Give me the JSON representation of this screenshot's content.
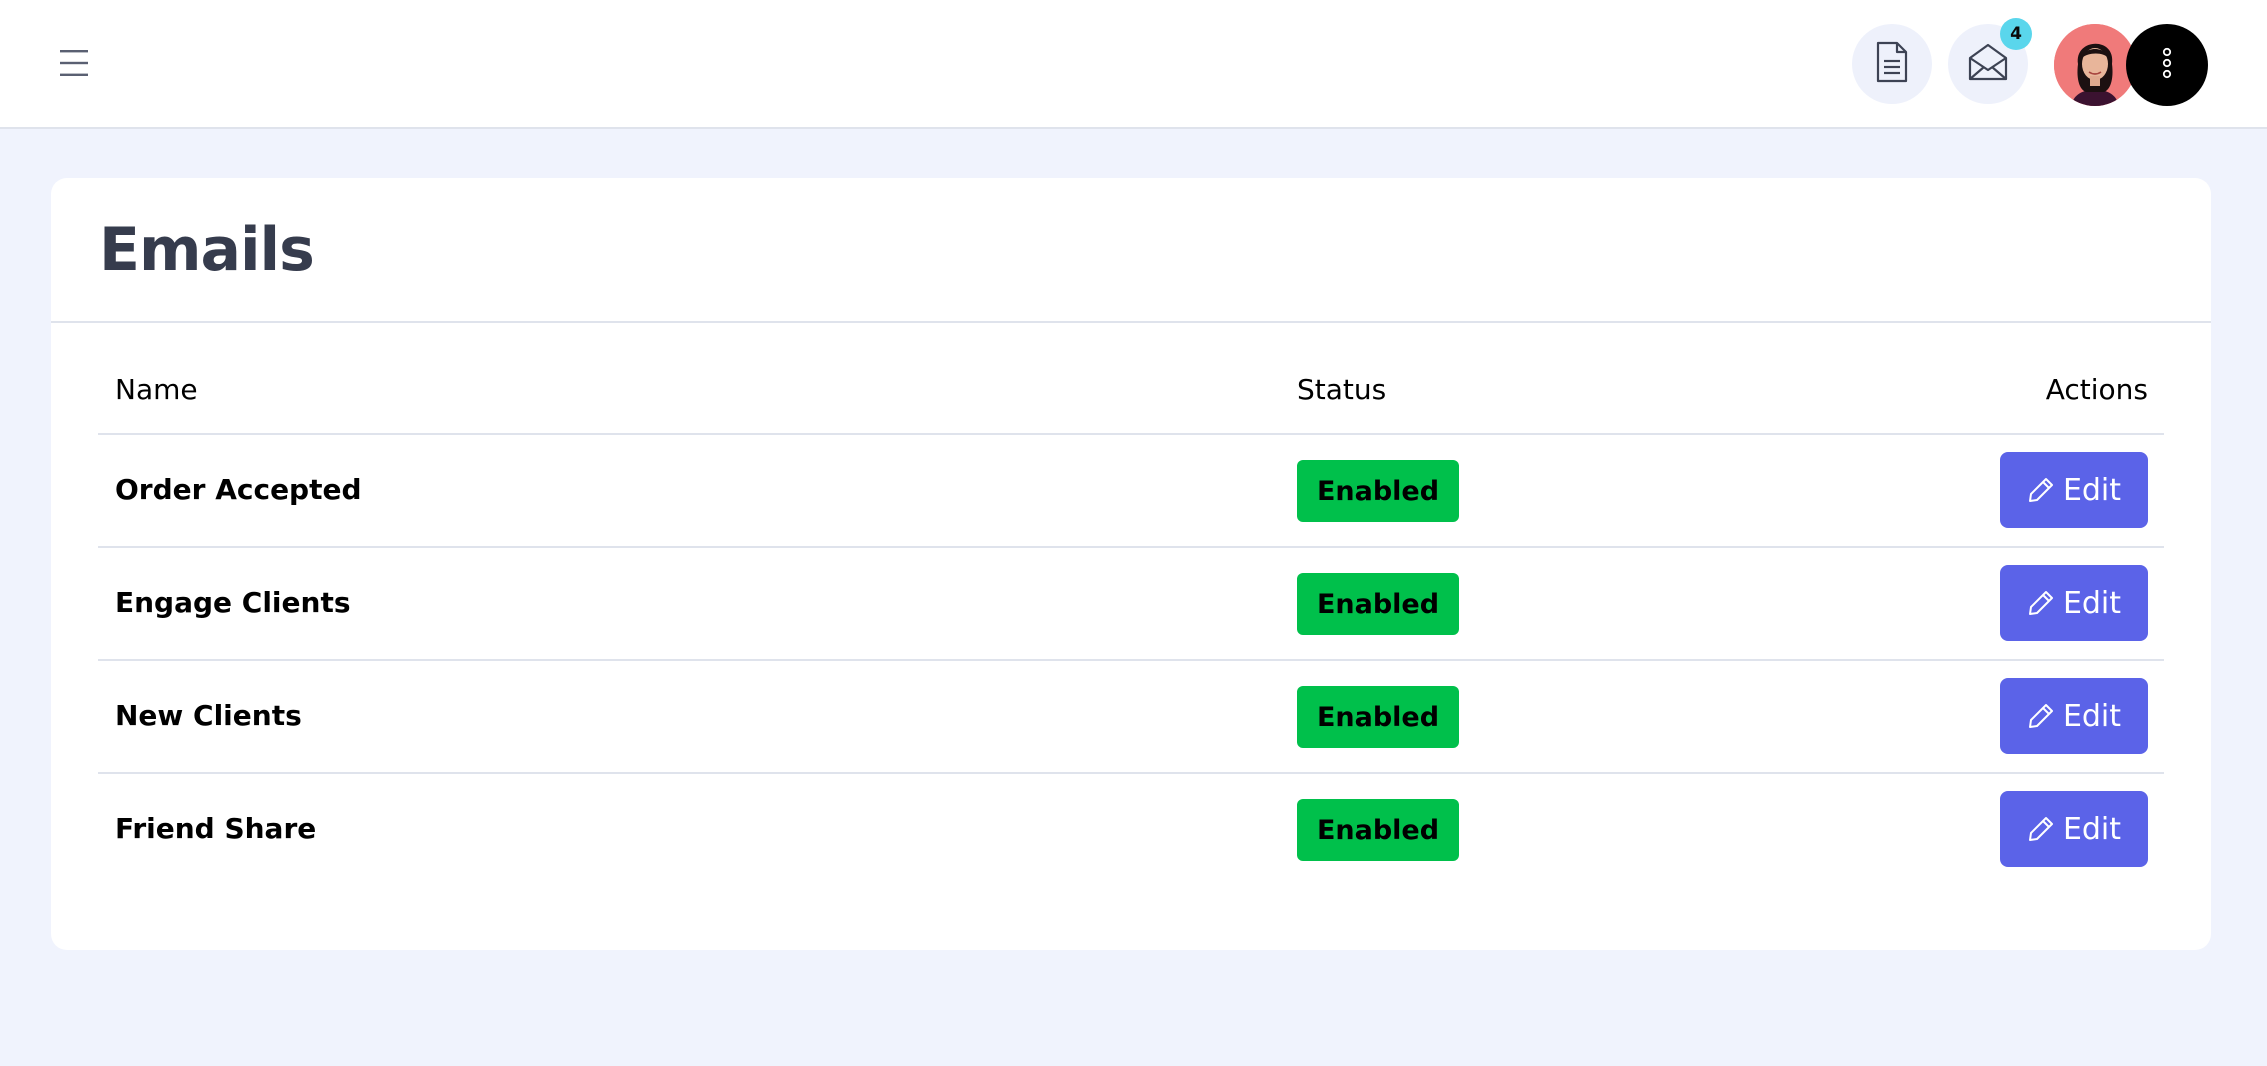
{
  "header": {
    "menu_icon": "hamburger-icon",
    "document_icon": "document-icon",
    "mail_icon": "envelope-open-icon",
    "mail_badge_count": "4",
    "avatar_icon": "user-avatar",
    "more_icon": "vertical-dots-icon"
  },
  "page": {
    "title": "Emails"
  },
  "table": {
    "columns": [
      "Name",
      "Status",
      "Actions"
    ],
    "rows": [
      {
        "name": "Order Accepted",
        "status": "Enabled",
        "action": "Edit"
      },
      {
        "name": "Engage Clients",
        "status": "Enabled",
        "action": "Edit"
      },
      {
        "name": "New Clients",
        "status": "Enabled",
        "action": "Edit"
      },
      {
        "name": "Friend Share",
        "status": "Enabled",
        "action": "Edit"
      }
    ]
  },
  "colors": {
    "background": "#f0f3fd",
    "status_enabled": "#00c04b",
    "edit_button": "#5b63e8",
    "badge": "#5ad6ec",
    "title": "#363c4d"
  }
}
